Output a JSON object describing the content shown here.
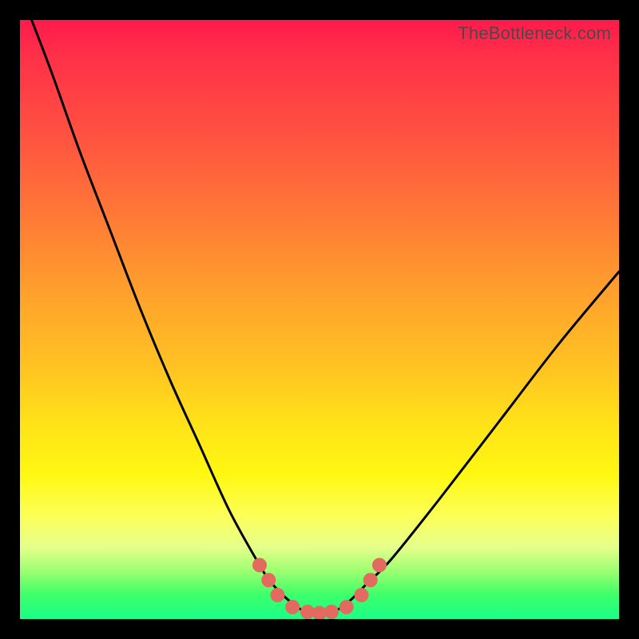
{
  "watermark": "TheBottleneck.com",
  "chart_data": {
    "type": "line",
    "title": "",
    "xlabel": "",
    "ylabel": "",
    "xlim": [
      0,
      100
    ],
    "ylim": [
      0,
      100
    ],
    "series": [
      {
        "name": "bottleneck-curve",
        "x": [
          0,
          5,
          10,
          15,
          20,
          25,
          30,
          35,
          40,
          42,
          45,
          48,
          50,
          52,
          55,
          58,
          62,
          70,
          80,
          90,
          100
        ],
        "values": [
          105,
          92,
          78,
          65,
          52,
          40,
          29,
          18,
          9,
          6,
          3,
          1,
          1,
          1,
          3,
          6,
          10,
          20,
          33,
          46,
          58
        ]
      }
    ],
    "markers": {
      "name": "highlight-dots",
      "color": "#e26a5f",
      "points": [
        {
          "x": 40.0,
          "y": 9.0
        },
        {
          "x": 41.5,
          "y": 6.5
        },
        {
          "x": 43.0,
          "y": 4.0
        },
        {
          "x": 45.5,
          "y": 2.0
        },
        {
          "x": 48.0,
          "y": 1.2
        },
        {
          "x": 50.0,
          "y": 1.0
        },
        {
          "x": 52.0,
          "y": 1.2
        },
        {
          "x": 54.5,
          "y": 2.0
        },
        {
          "x": 57.0,
          "y": 4.0
        },
        {
          "x": 58.5,
          "y": 6.5
        },
        {
          "x": 60.0,
          "y": 9.0
        }
      ]
    }
  }
}
